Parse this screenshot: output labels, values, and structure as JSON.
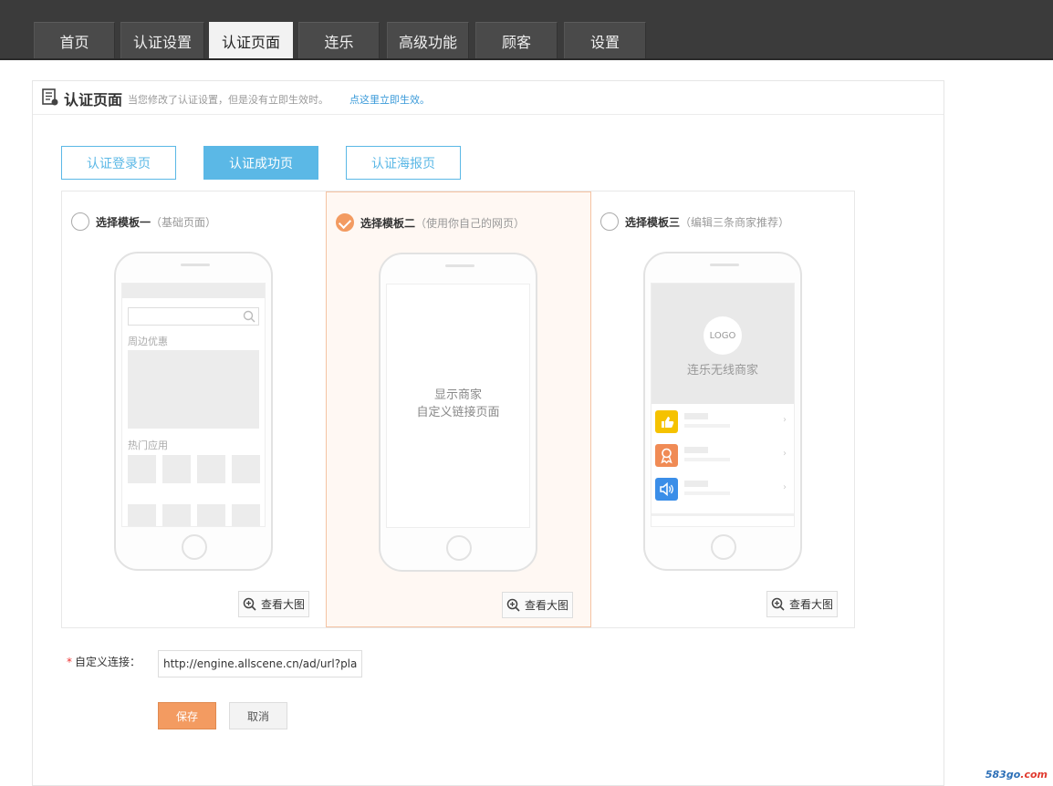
{
  "nav": {
    "tabs": [
      {
        "label": "首页"
      },
      {
        "label": "认证设置"
      },
      {
        "label": "认证页面",
        "active": true
      },
      {
        "label": "连乐"
      },
      {
        "label": "高级功能"
      },
      {
        "label": "顾客"
      },
      {
        "label": "设置"
      }
    ]
  },
  "panel": {
    "title": "认证页面",
    "note": "当您修改了认证设置，但是没有立即生效时。",
    "link": "点这里立即生效。"
  },
  "subtabs": [
    {
      "label": "认证登录页"
    },
    {
      "label": "认证成功页",
      "active": true
    },
    {
      "label": "认证海报页"
    }
  ],
  "templates": [
    {
      "title": "选择模板一",
      "subtitle": "（基础页面）",
      "checked": false,
      "screen": {
        "section1": "周边优惠",
        "section2": "热门应用"
      },
      "zoom_label": "查看大图"
    },
    {
      "title": "选择模板二",
      "subtitle": "（使用你自己的网页）",
      "checked": true,
      "screen": {
        "line1": "显示商家",
        "line2": "自定义链接页面"
      },
      "zoom_label": "查看大图"
    },
    {
      "title": "选择模板三",
      "subtitle": "（编辑三条商家推荐）",
      "checked": false,
      "screen": {
        "logo": "LOGO",
        "caption": "连乐无线商家"
      },
      "zoom_label": "查看大图"
    }
  ],
  "form": {
    "label": "自定义连接：",
    "required_mark": "*",
    "url_value": "http://engine.allscene.cn/ad/url?place",
    "save_label": "保存",
    "cancel_label": "取消"
  },
  "watermark": {
    "part1": "583go",
    "part2": ".com"
  },
  "colors": {
    "accent_blue": "#5bb8e6",
    "accent_orange": "#f39b61",
    "nav_bg": "#3b3b3b"
  }
}
